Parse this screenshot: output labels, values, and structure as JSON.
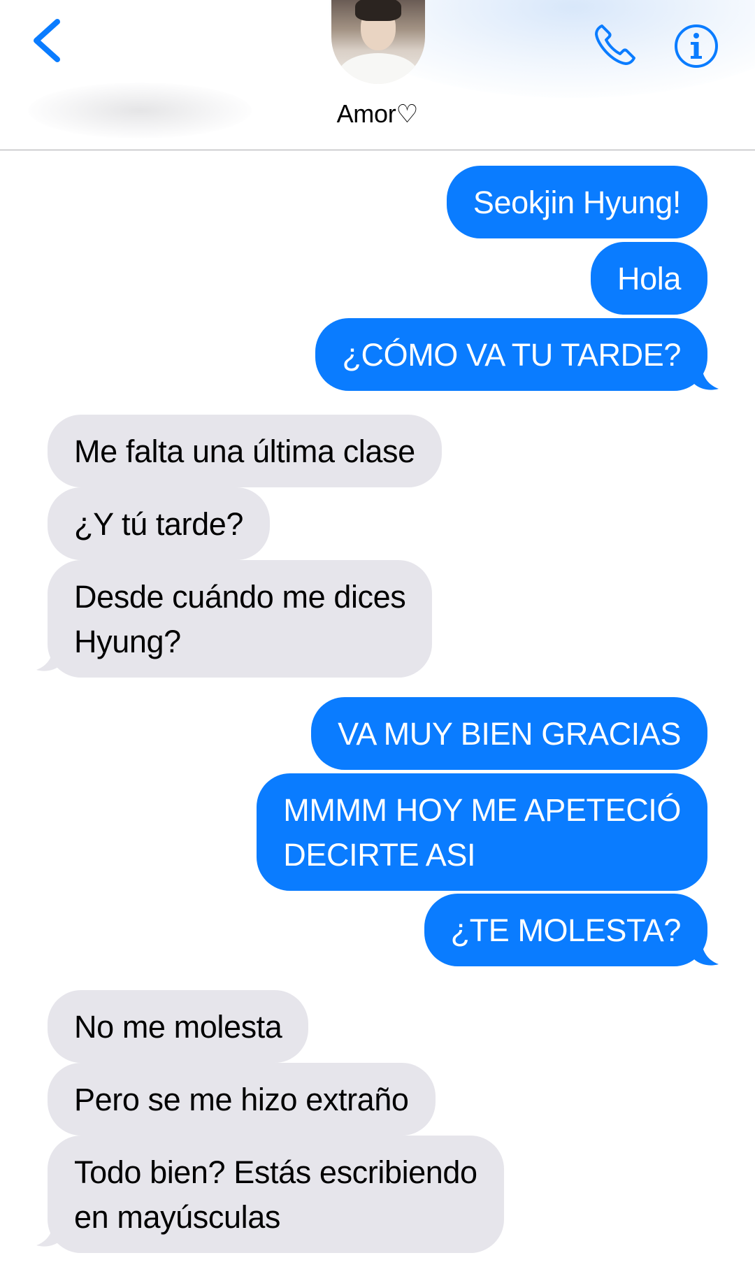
{
  "header": {
    "contact_name": "Amor♡",
    "back_icon": "chevron-left-icon",
    "call_icon": "phone-icon",
    "info_icon": "info-icon",
    "accent_color": "#0a7cff"
  },
  "colors": {
    "outgoing_bubble": "#0a7cff",
    "incoming_bubble": "#e6e5eb",
    "outgoing_text": "#ffffff",
    "incoming_text": "#000000"
  },
  "messages": [
    {
      "direction": "outgoing",
      "lines": [
        "Seokjin Hyung!"
      ]
    },
    {
      "direction": "outgoing",
      "lines": [
        "Hola"
      ]
    },
    {
      "direction": "outgoing",
      "lines": [
        "¿CÓMO VA TU TARDE?"
      ]
    },
    {
      "direction": "incoming",
      "lines": [
        "Me falta una última clase"
      ]
    },
    {
      "direction": "incoming",
      "lines": [
        "¿Y tú tarde?"
      ]
    },
    {
      "direction": "incoming",
      "lines": [
        "Desde cuándo me dices",
        "Hyung?"
      ]
    },
    {
      "direction": "outgoing",
      "lines": [
        "VA MUY BIEN GRACIAS"
      ]
    },
    {
      "direction": "outgoing",
      "lines": [
        "MMMM HOY ME APETECIÓ",
        "DECIRTE ASI"
      ]
    },
    {
      "direction": "outgoing",
      "lines": [
        "¿TE MOLESTA?"
      ]
    },
    {
      "direction": "incoming",
      "lines": [
        "No me molesta"
      ]
    },
    {
      "direction": "incoming",
      "lines": [
        "Pero se me hizo extraño"
      ]
    },
    {
      "direction": "incoming",
      "lines": [
        "Todo bien? Estás escribiendo",
        "en mayúsculas"
      ]
    }
  ]
}
